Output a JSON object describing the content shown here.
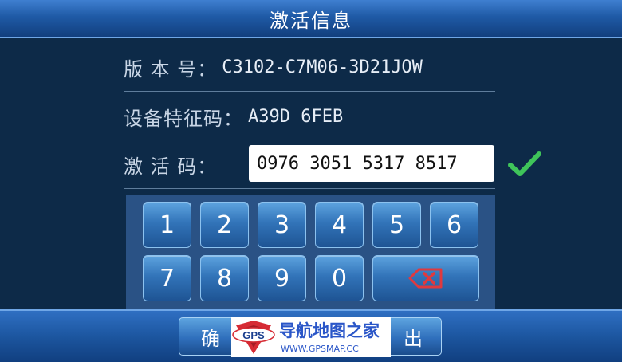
{
  "header": {
    "title": "激活信息"
  },
  "info": {
    "version_label": "版 本 号：",
    "version_value": "C3102-C7M06-3D21JOW",
    "device_label": "设备特征码：",
    "device_value": "A39D 6FEB",
    "activation_label": "激 活 码：",
    "activation_value": "0976 3051 5317 8517"
  },
  "keypad": {
    "keys": [
      "1",
      "2",
      "3",
      "4",
      "5",
      "6",
      "7",
      "8",
      "9",
      "0"
    ]
  },
  "footer": {
    "confirm_label": "确",
    "exit_label": "出"
  },
  "watermark": {
    "logo_text": "GPS",
    "title": "导航地图之家",
    "url": "WWW.GPSMAP.CC"
  },
  "colors": {
    "background": "#0d2a48",
    "title_bar": "#1f5aa6",
    "key_blue": "#3274b9",
    "check_green": "#3fc45a",
    "backspace_red": "#e0393e"
  }
}
